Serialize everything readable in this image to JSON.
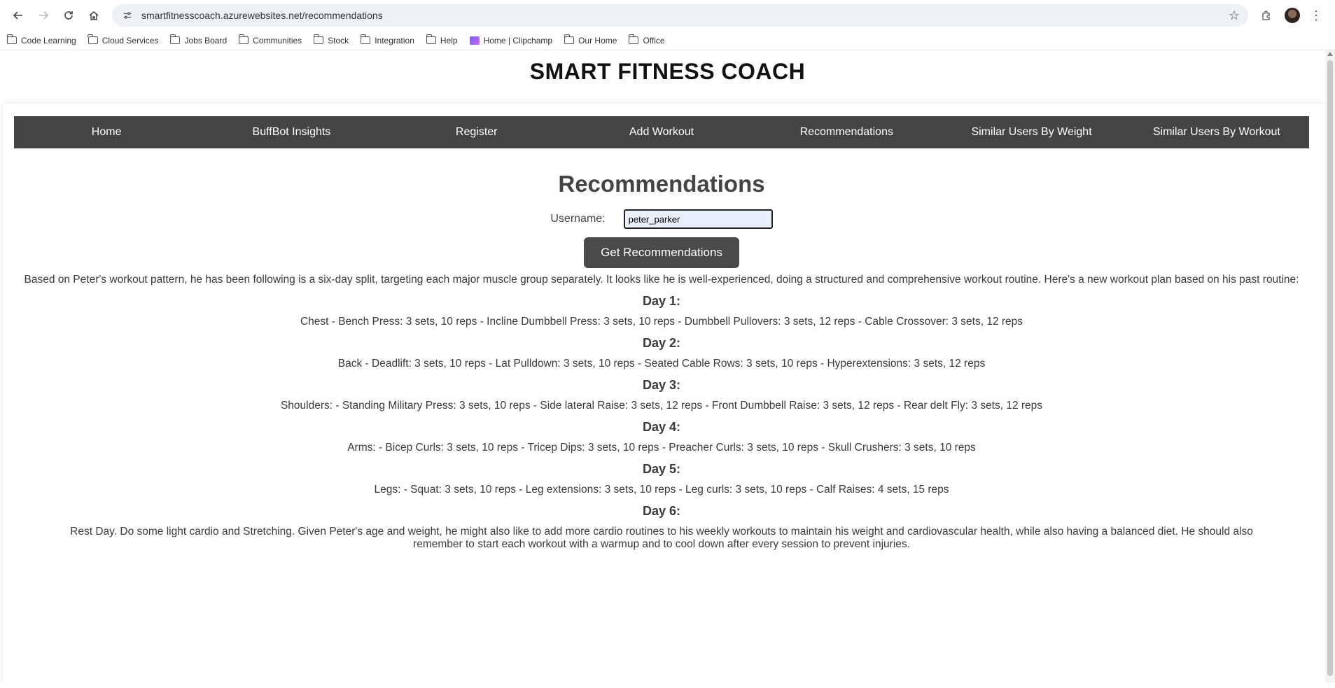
{
  "browser": {
    "url": "smartfitnesscoach.azurewebsites.net/recommendations",
    "bookmarks": [
      {
        "label": "Code Learning",
        "icon": "folder-icon"
      },
      {
        "label": "Cloud Services",
        "icon": "folder-icon"
      },
      {
        "label": "Jobs Board",
        "icon": "folder-icon"
      },
      {
        "label": "Communities",
        "icon": "folder-icon"
      },
      {
        "label": "Stock",
        "icon": "folder-icon"
      },
      {
        "label": "Integration",
        "icon": "folder-icon"
      },
      {
        "label": "Help",
        "icon": "folder-icon"
      },
      {
        "label": "Home | Clipchamp",
        "icon": "clipchamp-icon"
      },
      {
        "label": "Our Home",
        "icon": "folder-icon"
      },
      {
        "label": "Office",
        "icon": "folder-icon"
      }
    ]
  },
  "site": {
    "title": "SMART FITNESS COACH",
    "nav": [
      "Home",
      "BuffBot Insights",
      "Register",
      "Add Workout",
      "Recommendations",
      "Similar Users By Weight",
      "Similar Users By Workout"
    ]
  },
  "main": {
    "heading": "Recommendations",
    "username_label": "Username:",
    "username_value": "peter_parker",
    "button_label": "Get Recommendations",
    "intro": "Based on Peter's workout pattern, he has been following is a six-day split, targeting each major muscle group separately. It looks like he is well-experienced, doing a structured and comprehensive workout routine. Here's a new workout plan based on his past routine:",
    "days": [
      {
        "title": "Day 1:",
        "text": "Chest - Bench Press: 3 sets, 10 reps - Incline Dumbbell Press: 3 sets, 10 reps - Dumbbell Pullovers: 3 sets, 12 reps - Cable Crossover: 3 sets, 12 reps"
      },
      {
        "title": "Day 2:",
        "text": "Back - Deadlift: 3 sets, 10 reps - Lat Pulldown: 3 sets, 10 reps - Seated Cable Rows: 3 sets, 10 reps - Hyperextensions: 3 sets, 12 reps"
      },
      {
        "title": "Day 3:",
        "text": "Shoulders: - Standing Military Press: 3 sets, 10 reps - Side lateral Raise: 3 sets, 12 reps - Front Dumbbell Raise: 3 sets, 12 reps - Rear delt Fly: 3 sets, 12 reps"
      },
      {
        "title": "Day 4:",
        "text": "Arms: - Bicep Curls: 3 sets, 10 reps - Tricep Dips: 3 sets, 10 reps - Preacher Curls: 3 sets, 10 reps - Skull Crushers: 3 sets, 10 reps"
      },
      {
        "title": "Day 5:",
        "text": "Legs: - Squat: 3 sets, 10 reps - Leg extensions: 3 sets, 10 reps - Leg curls: 3 sets, 10 reps - Calf Raises: 4 sets, 15 reps"
      },
      {
        "title": "Day 6:",
        "text": "Rest Day. Do some light cardio and Stretching. Given Peter's age and weight, he might also like to add more cardio routines to his weekly workouts to maintain his weight and cardiovascular health, while also having a balanced diet. He should also remember to start each workout with a warmup and to cool down after every session to prevent injuries."
      }
    ]
  }
}
